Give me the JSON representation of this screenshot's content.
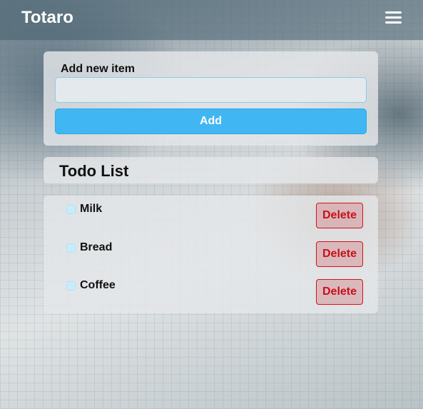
{
  "app": {
    "brand": "Totaro",
    "menu_icon": "hamburger-menu-icon"
  },
  "add_form": {
    "label": "Add new item",
    "input_value": "",
    "input_placeholder": "",
    "button_label": "Add"
  },
  "todo_list": {
    "title": "Todo List",
    "delete_label": "Delete",
    "items": [
      {
        "text": "Milk",
        "checked": false
      },
      {
        "text": "Bread",
        "checked": false
      },
      {
        "text": "Coffee",
        "checked": false
      }
    ]
  },
  "colors": {
    "add_button": "#40b6f2",
    "delete_text": "#c8101a",
    "checkbox": "#c9ecfb"
  }
}
